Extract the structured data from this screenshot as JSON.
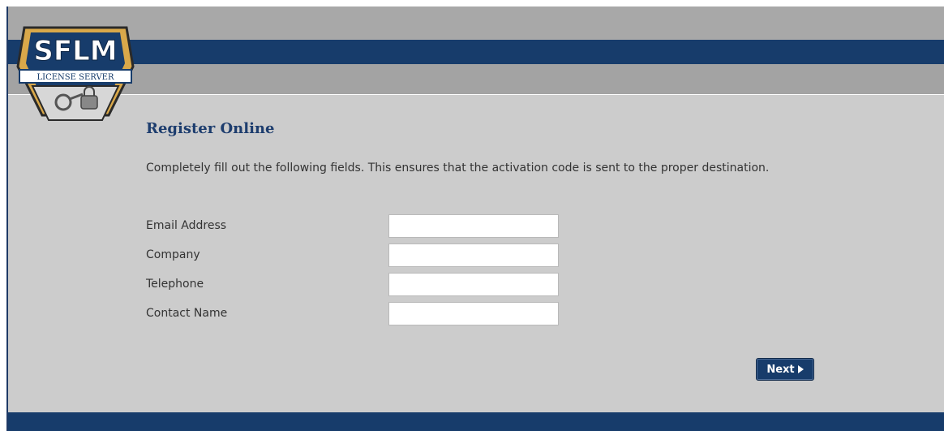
{
  "logo": {
    "name": "SFLM",
    "tagline": "LICENSE SERVER",
    "colors": {
      "gold": "#d9a84a",
      "navy": "#173c6b",
      "silver": "#d7d7d7"
    }
  },
  "form": {
    "title": "Register Online",
    "intro": "Completely fill out the following fields. This ensures that the activation code is sent to the proper destination.",
    "fields": [
      {
        "label": "Email Address",
        "value": ""
      },
      {
        "label": "Company",
        "value": ""
      },
      {
        "label": "Telephone",
        "value": ""
      },
      {
        "label": "Contact Name",
        "value": ""
      }
    ],
    "next_label": "Next"
  },
  "theme": {
    "background": "#cccccc",
    "navy": "#173c6b",
    "gray_band": "#a8a8a8"
  }
}
